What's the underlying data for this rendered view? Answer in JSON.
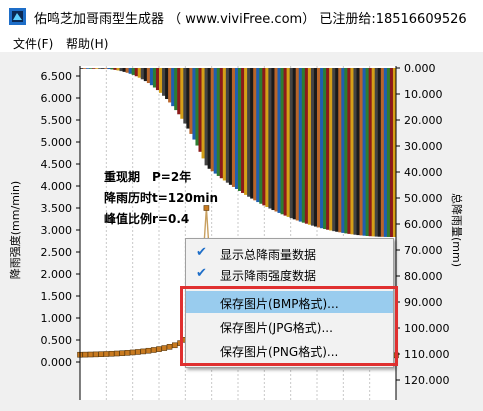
{
  "window": {
    "title": "佑鸣芝加哥雨型生成器 （ www.viviFree.com） 已注册给:18516609526",
    "icon": "app-icon"
  },
  "menu": [
    {
      "label": "文件(F)"
    },
    {
      "label": "帮助(H)"
    }
  ],
  "chart": {
    "left_axis_label": "降雨强度(mm/min)",
    "right_axis_label": "总降雨量(mm)",
    "left_ticks": [
      "6.500",
      "6.000",
      "5.500",
      "5.000",
      "4.500",
      "4.000",
      "3.500",
      "3.000",
      "2.500",
      "2.000",
      "1.500",
      "1.000",
      "0.500",
      "0.000"
    ],
    "right_ticks": [
      "0.000",
      "10.000",
      "20.000",
      "30.000",
      "40.000",
      "50.000",
      "60.000",
      "70.000",
      "80.000",
      "90.000",
      "100.000",
      "110.000",
      "120.000"
    ],
    "annotations": {
      "period": "重现期　P=2年",
      "duration": "降雨历时t=120min",
      "peak_ratio": "峰值比例r=0.4"
    },
    "colors": {
      "bars": [
        "#1a1a1a",
        "#b8652a",
        "#1f5fb0",
        "#2e7d32",
        "#8b1a1a",
        "#d4a017",
        "#444444"
      ],
      "intensity_line": "#c8a060",
      "marker": "#c87a20"
    }
  },
  "context_menu": {
    "items": [
      {
        "label": "显示总降雨量数据",
        "checked": true
      },
      {
        "label": "显示降雨强度数据",
        "checked": true
      },
      {
        "label": "保存图片(BMP格式)...",
        "highlighted": true
      },
      {
        "label": "保存图片(JPG格式)..."
      },
      {
        "label": "保存图片(PNG格式)..."
      }
    ]
  }
}
